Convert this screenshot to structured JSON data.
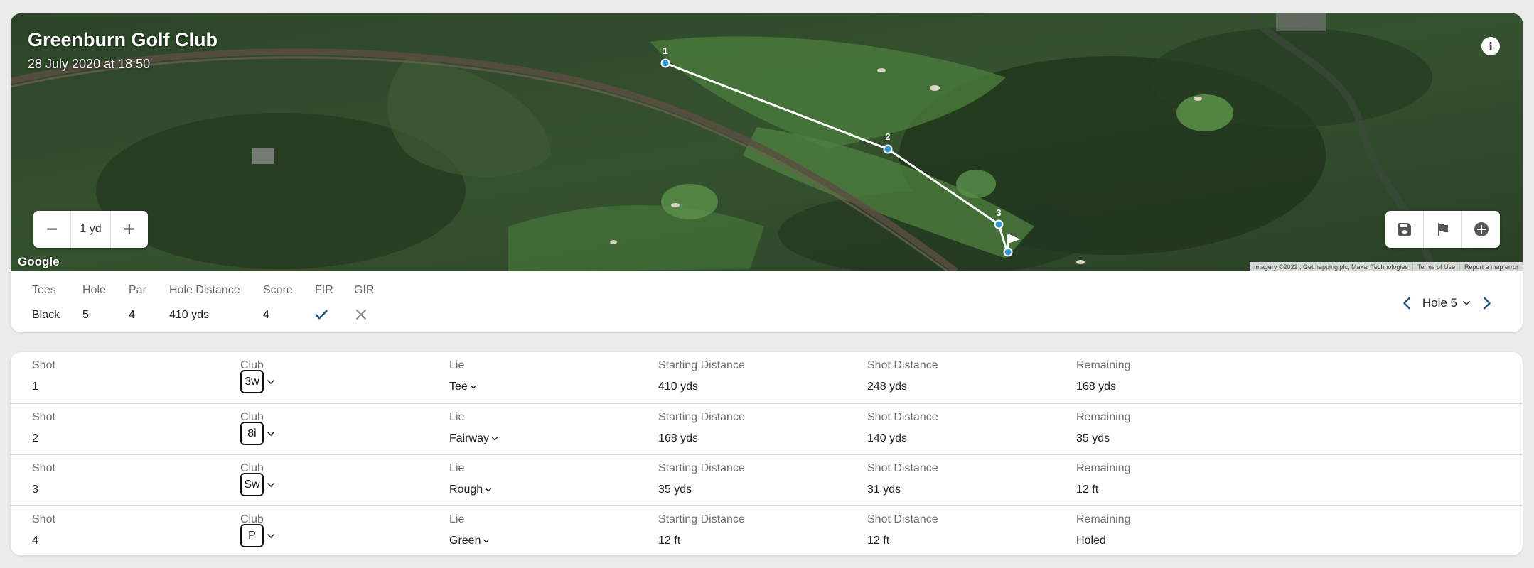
{
  "map": {
    "title": "Greenburn Golf Club",
    "date": "28 July 2020 at 18:50",
    "zoom_value": "1 yd",
    "zoom_minus": "−",
    "zoom_plus": "+",
    "info_glyph": "i",
    "google_logo": "Google",
    "attribution": [
      "Imagery ©2022 , Getmapping plc, Maxar Technologies",
      "Terms of Use",
      "Report a map error"
    ],
    "markers": [
      "1",
      "2",
      "3"
    ],
    "icons": [
      "info-icon",
      "save-icon",
      "flag-icon",
      "add-circle-icon",
      "pin-flag-icon"
    ]
  },
  "hole_info": {
    "labels": {
      "tees": "Tees",
      "hole": "Hole",
      "par": "Par",
      "distance": "Hole Distance",
      "score": "Score",
      "fir": "FIR",
      "gir": "GIR"
    },
    "values": {
      "tees": "Black",
      "hole": "5",
      "par": "4",
      "distance": "410 yds",
      "score": "4",
      "fir": "check",
      "gir": "cross"
    },
    "nav_label": "Hole 5"
  },
  "shots_labels": {
    "shot": "Shot",
    "club": "Club",
    "lie": "Lie",
    "start": "Starting Distance",
    "shot_distance": "Shot Distance",
    "remaining": "Remaining"
  },
  "shots": [
    {
      "shot": "1",
      "club": "3w",
      "lie": "Tee",
      "start": "410 yds",
      "shot_distance": "248 yds",
      "remaining": "168 yds"
    },
    {
      "shot": "2",
      "club": "8i",
      "lie": "Fairway",
      "start": "168 yds",
      "shot_distance": "140 yds",
      "remaining": "35 yds"
    },
    {
      "shot": "3",
      "club": "Sw",
      "lie": "Rough",
      "start": "35 yds",
      "shot_distance": "31 yds",
      "remaining": "12 ft"
    },
    {
      "shot": "4",
      "club": "P",
      "lie": "Green",
      "start": "12 ft",
      "shot_distance": "12 ft",
      "remaining": "Holed"
    }
  ],
  "colors": {
    "accent": "#1d4f7a",
    "marker": "#2f9bd6",
    "gir_cross": "#888888"
  }
}
